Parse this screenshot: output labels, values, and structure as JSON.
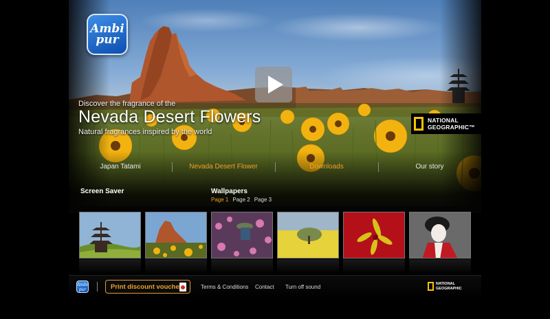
{
  "brand": {
    "logo_line1": "Ambi",
    "logo_line2": "pur"
  },
  "hero": {
    "kicker": "Discover the fragrance of the",
    "title": "Nevada Desert Flowers",
    "subtitle": "Natural fragrances inspired by the world",
    "play_icon": "play-icon"
  },
  "partner": {
    "line1": "NATIONAL",
    "line2": "GEOGRAPHIC™"
  },
  "nav": {
    "items": [
      {
        "label": "Japan Tatami"
      },
      {
        "label": "Nevada Desert Flower"
      },
      {
        "label": "Downloads"
      },
      {
        "label": "Our story"
      }
    ],
    "active_index": 1
  },
  "sections": {
    "screen_saver": "Screen Saver",
    "wallpapers": "Wallpapers",
    "pages": [
      "Page 1",
      "Page 2",
      "Page 3"
    ],
    "current_page": "Page 1"
  },
  "footer": {
    "logo_line1": "Ambi",
    "logo_line2": "pur",
    "voucher": "Print discount voucher",
    "terms": "Terms & Conditions",
    "contact": "Contact",
    "sound": "Turn off sound",
    "partner_line1": "NATIONAL",
    "partner_line2": "GEOGRAPHIC"
  },
  "colors": {
    "accent": "#f0a22a",
    "background": "#000000",
    "natgeo_yellow": "#f7c600",
    "logo_blue": "#1e6fd0"
  }
}
